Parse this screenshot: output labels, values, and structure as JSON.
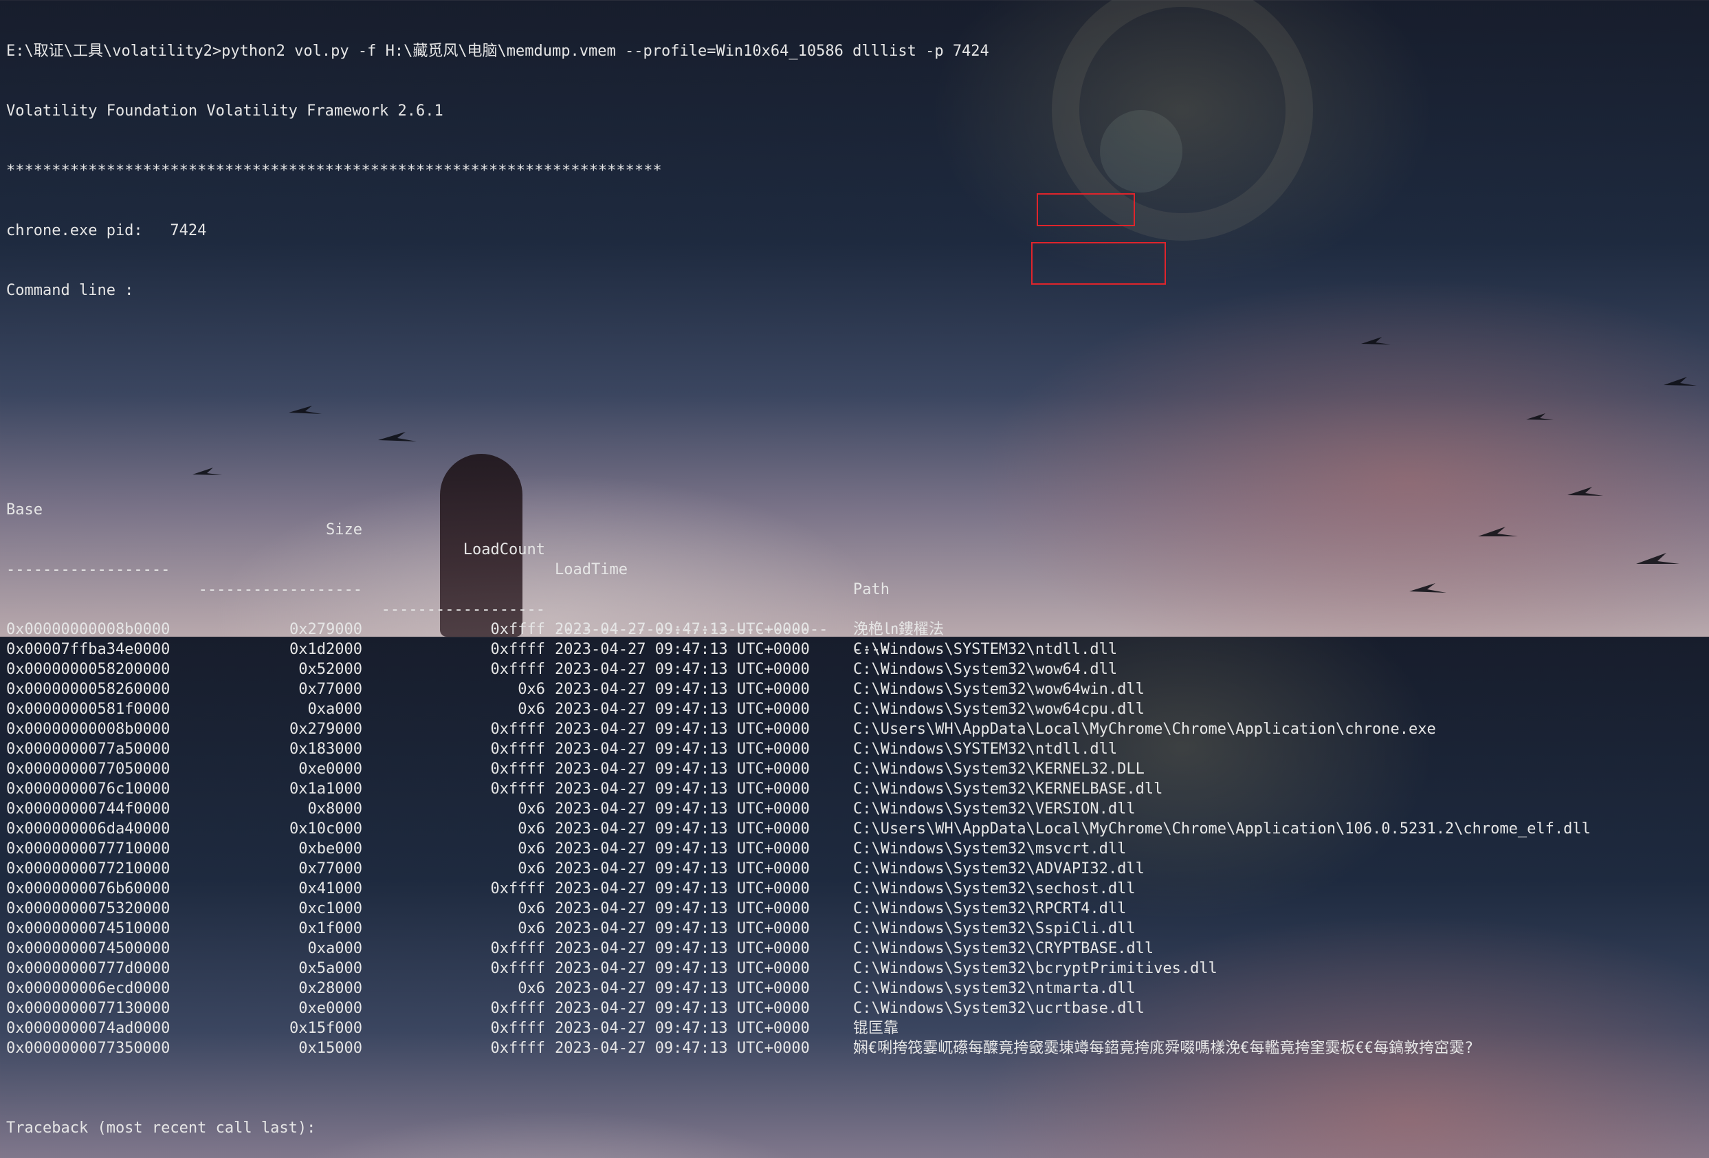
{
  "terminal": {
    "command": "E:\\取证\\工具\\volatility2>python2 vol.py -f H:\\藏觅风\\电脑\\memdump.vmem --profile=Win10x64_10586 dlllist -p 7424",
    "banner": "Volatility Foundation Volatility Framework 2.6.1",
    "separator": "************************************************************************",
    "pid_line": "chrone.exe pid:   7424",
    "cmdline": "Command line :",
    "headers": {
      "base": "Base",
      "size": "Size",
      "loadcount": "LoadCount",
      "loadtime": "LoadTime",
      "path": "Path"
    },
    "dashes": {
      "base": "------------------",
      "size": "------------------",
      "loadcount": "------------------",
      "loadtime": "------------------------------",
      "path": "----"
    },
    "rows": [
      {
        "base": "0x00000000008b0000",
        "size": "0x279000",
        "loadcount": "0xffff",
        "loadtime": "2023-04-27 09:47:13 UTC+0000",
        "path": "浼栬㏑鏤櫂法"
      },
      {
        "base": "0x00007ffba34e0000",
        "size": "0x1d2000",
        "loadcount": "0xffff",
        "loadtime": "2023-04-27 09:47:13 UTC+0000",
        "path": "C:\\Windows\\SYSTEM32\\ntdll.dll"
      },
      {
        "base": "0x0000000058200000",
        "size": "0x52000",
        "loadcount": "0xffff",
        "loadtime": "2023-04-27 09:47:13 UTC+0000",
        "path": "C:\\Windows\\System32\\wow64.dll"
      },
      {
        "base": "0x0000000058260000",
        "size": "0x77000",
        "loadcount": "0x6",
        "loadtime": "2023-04-27 09:47:13 UTC+0000",
        "path": "C:\\Windows\\System32\\wow64win.dll"
      },
      {
        "base": "0x00000000581f0000",
        "size": "0xa000",
        "loadcount": "0x6",
        "loadtime": "2023-04-27 09:47:13 UTC+0000",
        "path": "C:\\Windows\\System32\\wow64cpu.dll"
      },
      {
        "base": "0x00000000008b0000",
        "size": "0x279000",
        "loadcount": "0xffff",
        "loadtime": "2023-04-27 09:47:13 UTC+0000",
        "path": "C:\\Users\\WH\\AppData\\Local\\MyChrome\\Chrome\\Application\\chrone.exe"
      },
      {
        "base": "0x0000000077a50000",
        "size": "0x183000",
        "loadcount": "0xffff",
        "loadtime": "2023-04-27 09:47:13 UTC+0000",
        "path": "C:\\Windows\\SYSTEM32\\ntdll.dll"
      },
      {
        "base": "0x0000000077050000",
        "size": "0xe0000",
        "loadcount": "0xffff",
        "loadtime": "2023-04-27 09:47:13 UTC+0000",
        "path": "C:\\Windows\\System32\\KERNEL32.DLL"
      },
      {
        "base": "0x0000000076c10000",
        "size": "0x1a1000",
        "loadcount": "0xffff",
        "loadtime": "2023-04-27 09:47:13 UTC+0000",
        "path": "C:\\Windows\\System32\\KERNELBASE.dll"
      },
      {
        "base": "0x00000000744f0000",
        "size": "0x8000",
        "loadcount": "0x6",
        "loadtime": "2023-04-27 09:47:13 UTC+0000",
        "path": "C:\\Windows\\System32\\VERSION.dll"
      },
      {
        "base": "0x000000006da40000",
        "size": "0x10c000",
        "loadcount": "0x6",
        "loadtime": "2023-04-27 09:47:13 UTC+0000",
        "path": "C:\\Users\\WH\\AppData\\Local\\MyChrome\\Chrome\\Application\\106.0.5231.2\\chrome_elf.dll"
      },
      {
        "base": "0x0000000077710000",
        "size": "0xbe000",
        "loadcount": "0x6",
        "loadtime": "2023-04-27 09:47:13 UTC+0000",
        "path": "C:\\Windows\\System32\\msvcrt.dll"
      },
      {
        "base": "0x0000000077210000",
        "size": "0x77000",
        "loadcount": "0x6",
        "loadtime": "2023-04-27 09:47:13 UTC+0000",
        "path": "C:\\Windows\\System32\\ADVAPI32.dll"
      },
      {
        "base": "0x0000000076b60000",
        "size": "0x41000",
        "loadcount": "0xffff",
        "loadtime": "2023-04-27 09:47:13 UTC+0000",
        "path": "C:\\Windows\\System32\\sechost.dll"
      },
      {
        "base": "0x0000000075320000",
        "size": "0xc1000",
        "loadcount": "0x6",
        "loadtime": "2023-04-27 09:47:13 UTC+0000",
        "path": "C:\\Windows\\System32\\RPCRT4.dll"
      },
      {
        "base": "0x0000000074510000",
        "size": "0x1f000",
        "loadcount": "0x6",
        "loadtime": "2023-04-27 09:47:13 UTC+0000",
        "path": "C:\\Windows\\System32\\SspiCli.dll"
      },
      {
        "base": "0x0000000074500000",
        "size": "0xa000",
        "loadcount": "0xffff",
        "loadtime": "2023-04-27 09:47:13 UTC+0000",
        "path": "C:\\Windows\\System32\\CRYPTBASE.dll"
      },
      {
        "base": "0x00000000777d0000",
        "size": "0x5a000",
        "loadcount": "0xffff",
        "loadtime": "2023-04-27 09:47:13 UTC+0000",
        "path": "C:\\Windows\\System32\\bcryptPrimitives.dll"
      },
      {
        "base": "0x000000006ecd0000",
        "size": "0x28000",
        "loadcount": "0x6",
        "loadtime": "2023-04-27 09:47:13 UTC+0000",
        "path": "C:\\Windows\\system32\\ntmarta.dll"
      },
      {
        "base": "0x0000000077130000",
        "size": "0xe0000",
        "loadcount": "0xffff",
        "loadtime": "2023-04-27 09:47:13 UTC+0000",
        "path": "C:\\Windows\\System32\\ucrtbase.dll"
      },
      {
        "base": "0x0000000074ad0000",
        "size": "0x15f000",
        "loadcount": "0xffff",
        "loadtime": "2023-04-27 09:47:13 UTC+0000",
        "path": "锟匡靠"
      },
      {
        "base": "0x0000000077350000",
        "size": "0x15000",
        "loadcount": "0xffff",
        "loadtime": "2023-04-27 09:47:13 UTC+0000",
        "path": "娴€唎挎筏霎屼礤每醾竟挎窢霙埬竴每鍣竟挎庣舜啜嗎樣浼€每轞竟挎窐霙板€€每鎬敦挎窋霙?"
      }
    ],
    "traceback": "Traceback (most recent call last):"
  },
  "colors": {
    "text": "#e6e6e6",
    "highlight": "#e0242b"
  }
}
